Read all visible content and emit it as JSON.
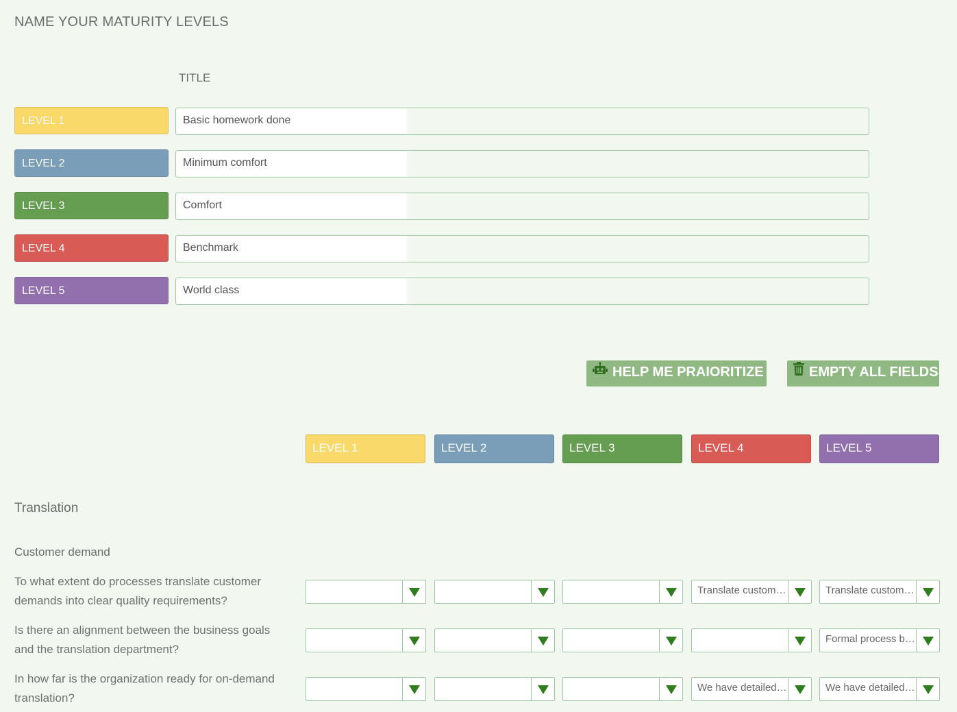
{
  "page": {
    "title": "NAME YOUR MATURITY LEVELS",
    "title_column_header": "TITLE"
  },
  "colors": {
    "level1": "#f9d96a",
    "level2": "#7a9eb8",
    "level3": "#659d51",
    "level4": "#d95b55",
    "level5": "#9270ae",
    "button": "#90b882",
    "accent_arrow": "#2f7d1e"
  },
  "levels": [
    {
      "label": "LEVEL 1",
      "title": "Basic homework done"
    },
    {
      "label": "LEVEL 2",
      "title": "Minimum comfort"
    },
    {
      "label": "LEVEL 3",
      "title": "Comfort"
    },
    {
      "label": "LEVEL 4",
      "title": "Benchmark"
    },
    {
      "label": "LEVEL 5",
      "title": "World class"
    }
  ],
  "actions": {
    "help_label": "HELP ME PRAIORITIZE",
    "help_icon": "robot-icon",
    "empty_label": "EMPTY ALL FIELDS",
    "empty_icon": "trash-icon"
  },
  "matrix": {
    "columns": [
      "LEVEL 1",
      "LEVEL 2",
      "LEVEL 3",
      "LEVEL 4",
      "LEVEL 5"
    ],
    "section": "Translation",
    "subsection": "Customer demand",
    "questions": [
      {
        "text": "To what extent do processes translate customer demands into clear quality requirements?",
        "answers": [
          "",
          "",
          "",
          "Translate customer demands into clear quality requirements",
          "Translate customer demands into clear quality requirements"
        ]
      },
      {
        "text": "Is there an alignment between the business goals and the translation department?",
        "answers": [
          "",
          "",
          "",
          "",
          "Formal process between business goals and translation"
        ]
      },
      {
        "text": "In how far is the organization ready for on-demand translation?",
        "answers": [
          "",
          "",
          "",
          "We have detailed plans",
          "We have detailed plans"
        ]
      }
    ]
  }
}
